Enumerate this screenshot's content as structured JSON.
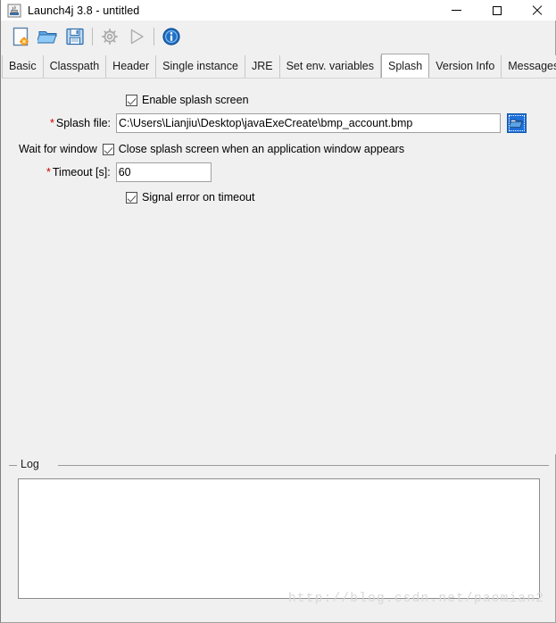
{
  "window": {
    "title": "Launch4j 3.8 - untitled",
    "app_icon": "java-application-icon",
    "controls": {
      "minimize": "minimize-icon",
      "maximize": "maximize-icon",
      "close": "close-icon"
    }
  },
  "toolbar": {
    "items": [
      {
        "name": "new-file-button",
        "icon": "new-file-icon",
        "enabled": true
      },
      {
        "name": "open-file-button",
        "icon": "open-folder-icon",
        "enabled": true
      },
      {
        "name": "save-file-button",
        "icon": "save-disk-icon",
        "enabled": true
      },
      {
        "name": "build-wrapper-button",
        "icon": "gear-icon",
        "enabled": false
      },
      {
        "name": "run-button",
        "icon": "play-triangle-icon",
        "enabled": false
      },
      {
        "name": "info-button",
        "icon": "info-circle-icon",
        "enabled": true
      }
    ]
  },
  "tabs": [
    {
      "label": "Basic",
      "active": false
    },
    {
      "label": "Classpath",
      "active": false
    },
    {
      "label": "Header",
      "active": false
    },
    {
      "label": "Single instance",
      "active": false
    },
    {
      "label": "JRE",
      "active": false
    },
    {
      "label": "Set env. variables",
      "active": false
    },
    {
      "label": "Splash",
      "active": true
    },
    {
      "label": "Version Info",
      "active": false
    },
    {
      "label": "Messages",
      "active": false
    }
  ],
  "splash_panel": {
    "enable_splash": {
      "label": "Enable splash screen",
      "checked": true
    },
    "splash_file": {
      "required_marker": "*",
      "label": "Splash file:",
      "value": "C:\\Users\\Lianjiu\\Desktop\\javaExeCreate\\bmp_account.bmp",
      "placeholder": "",
      "browse_icon": "open-folder-icon"
    },
    "wait_for_window": {
      "label": "Wait for window",
      "checkbox_label": "Close splash screen when an application window appears",
      "checked": true
    },
    "timeout": {
      "required_marker": "*",
      "label": "Timeout [s]:",
      "value": "60",
      "placeholder": ""
    },
    "signal_error": {
      "label": "Signal error on timeout",
      "checked": true
    }
  },
  "log": {
    "legend": "Log",
    "content": ""
  },
  "watermark": {
    "text": "http://blog.csdn.net/paomian2"
  },
  "colors": {
    "window_bg": "#f0f0f0",
    "field_bg": "#ffffff",
    "accent_blue": "#1e6fd9",
    "required_red": "#cc0000",
    "border_gray": "#a0a0a0"
  }
}
